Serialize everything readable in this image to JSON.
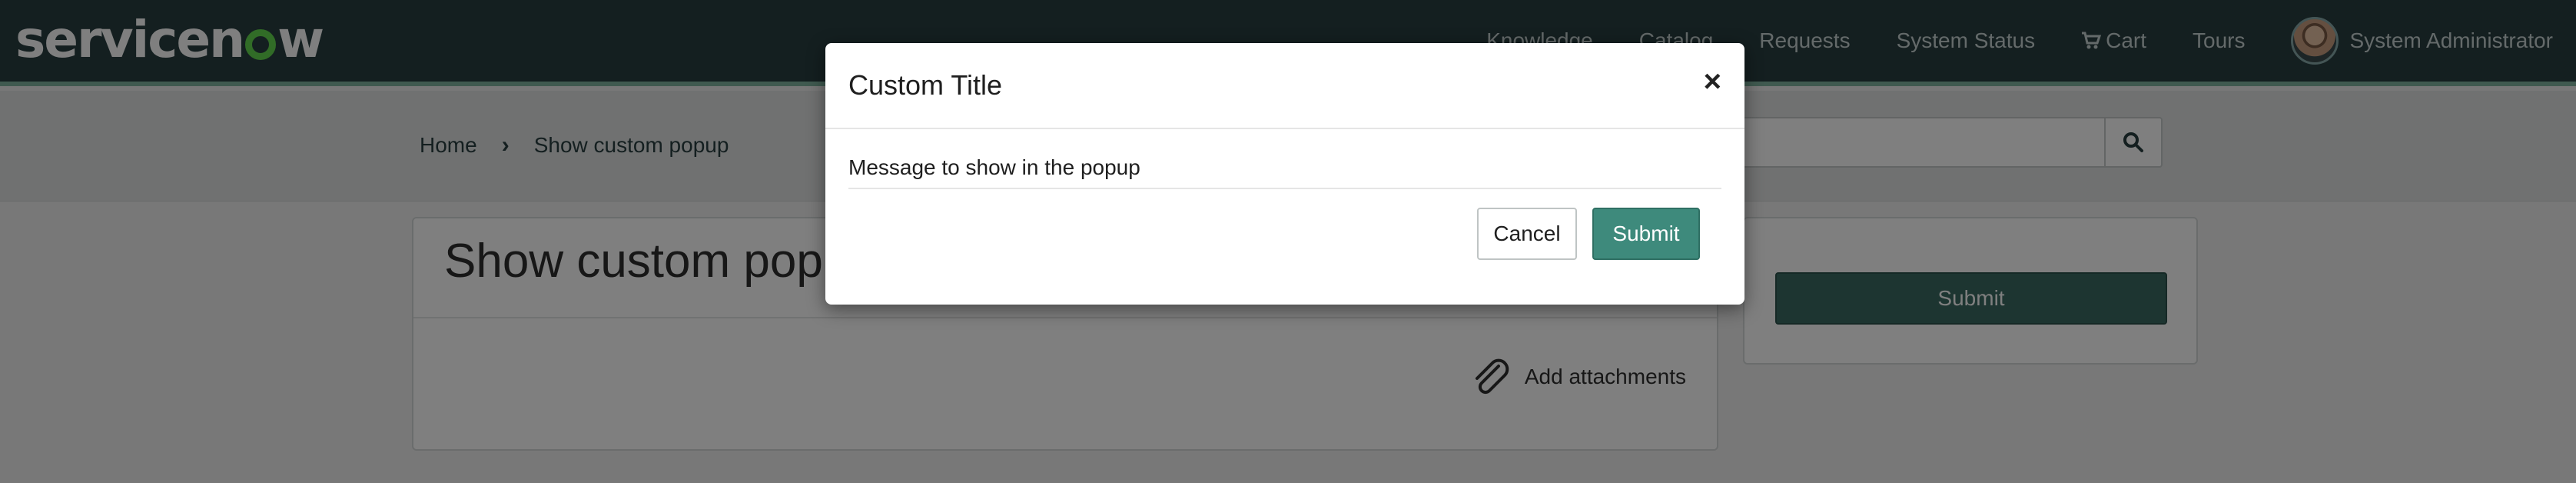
{
  "header": {
    "logo_text_1": "servicen",
    "logo_text_2": "w",
    "nav": {
      "knowledge": "Knowledge",
      "catalog": "Catalog",
      "requests": "Requests",
      "system_status": "System Status",
      "cart": "Cart",
      "tours": "Tours",
      "user": "System Administrator"
    },
    "colors": {
      "bar": "#293e40",
      "accent": "#81b5a1",
      "logo_o": "#62d84e"
    }
  },
  "breadcrumb": {
    "home": "Home",
    "current": "Show custom popup"
  },
  "main": {
    "title": "Show custom popup",
    "attachments_label": "Add attachments",
    "submit_label": "Submit"
  },
  "modal": {
    "title": "Custom Title",
    "close_glyph": "×",
    "message": "Message to show in the popup",
    "cancel_label": "Cancel",
    "submit_label": "Submit"
  }
}
